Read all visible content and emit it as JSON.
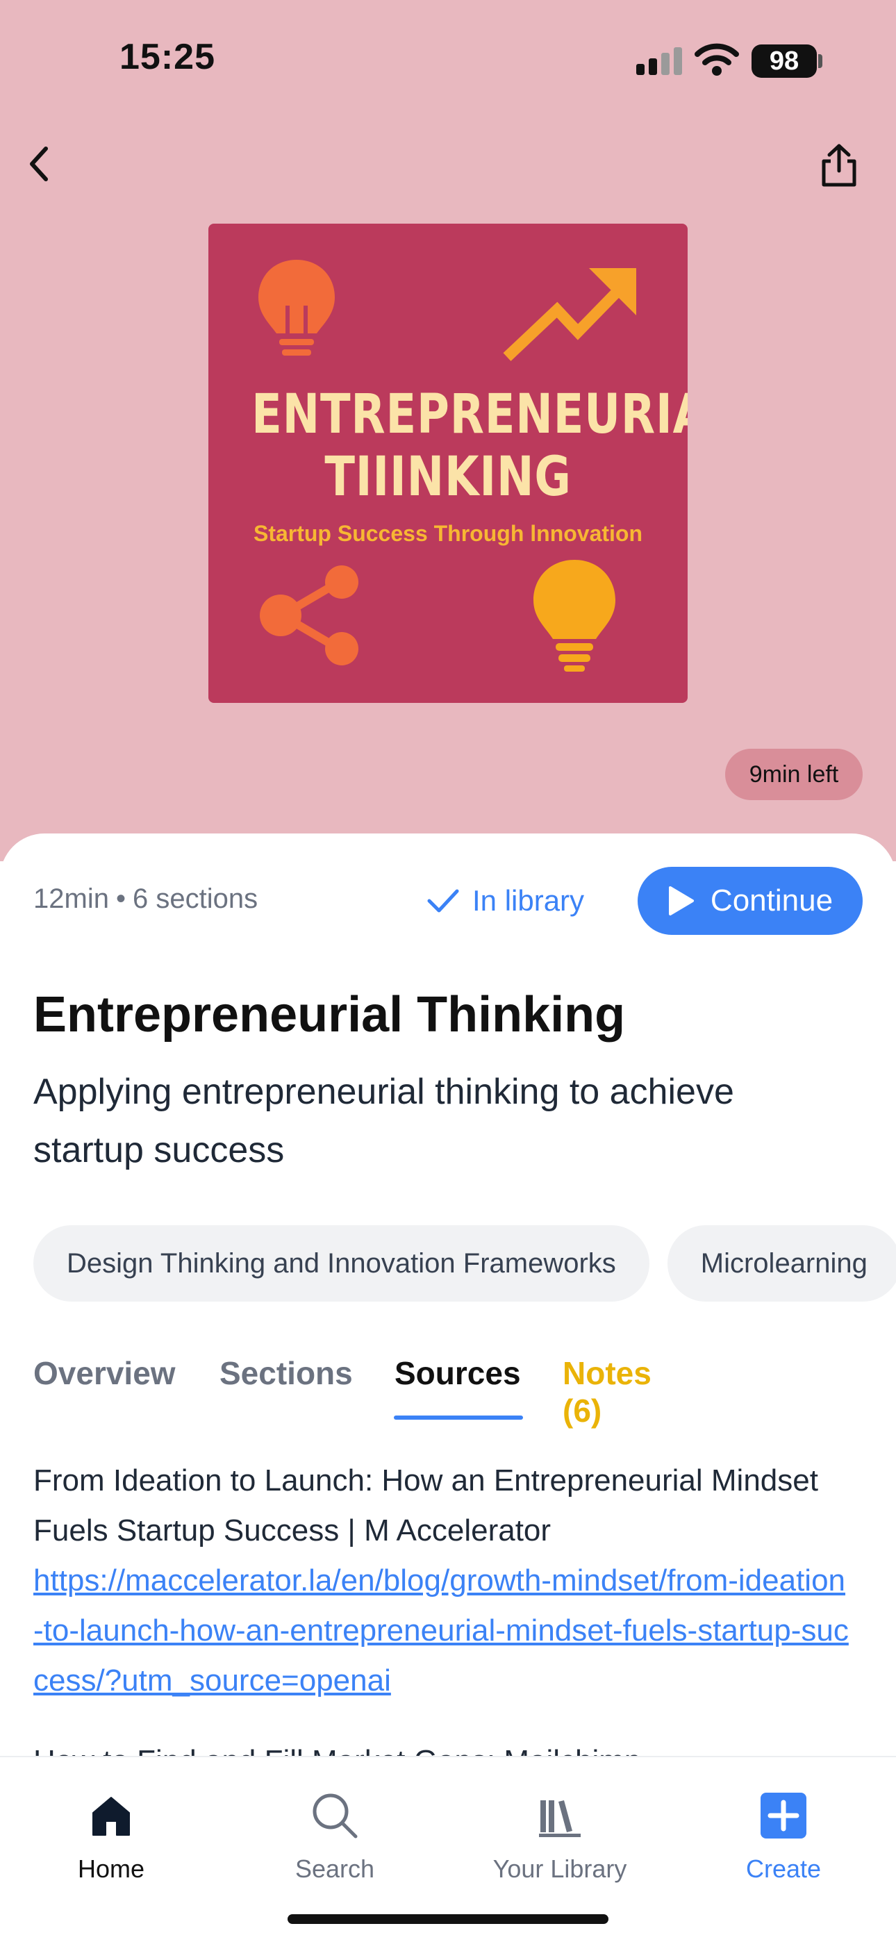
{
  "status_bar": {
    "time": "15:25",
    "battery": "98",
    "icons": [
      "cellular-signal-icon",
      "wifi-icon",
      "battery-icon"
    ]
  },
  "nav": {
    "back_icon": "chevron-left-icon",
    "share_icon": "share-icon"
  },
  "cover": {
    "title_line1": "ENTREPRENEURIAL",
    "title_line2": "TIIINKING",
    "subtitle": "Startup Success Through lnnovation",
    "colors": {
      "background": "#bb3a5c",
      "title": "#fbe3a8",
      "accent": "#f7b733",
      "orange": "#f26b3a"
    }
  },
  "time_left": "9min left",
  "meta": {
    "duration": "12min",
    "separator": "•",
    "sections": "6 sections"
  },
  "actions": {
    "in_library_label": "In library",
    "continue_label": "Continue"
  },
  "course": {
    "title": "Entrepreneurial Thinking",
    "subtitle": "Applying entrepreneurial thinking to achieve startup success"
  },
  "chips": [
    {
      "label": "Design Thinking and Innovation Frameworks"
    },
    {
      "label": "Microlearning"
    }
  ],
  "tabs": [
    {
      "label": "Overview"
    },
    {
      "label": "Sections"
    },
    {
      "label": "Sources",
      "active": true
    },
    {
      "label": "Notes (6)"
    }
  ],
  "sources": [
    {
      "title": "From Ideation to Launch: How an Entrepreneurial Mindset Fuels Startup Success | M Accelerator",
      "url": "https://maccelerator.la/en/blog/growth-mindset/from-ideation-to-launch-how-an-entrepreneurial-mindset-fuels-startup-success/?utm_source=openai"
    },
    {
      "title": "How to Find and Fill Market Gaps: Mailchimp"
    }
  ],
  "tab_bar": [
    {
      "label": "Home",
      "icon": "home-icon",
      "active": true
    },
    {
      "label": "Search",
      "icon": "search-icon"
    },
    {
      "label": "Your Library",
      "icon": "library-icon"
    },
    {
      "label": "Create",
      "icon": "plus-square-icon"
    }
  ],
  "colors": {
    "hero_background": "#e8b8bf",
    "accent_blue": "#3b82f6",
    "notes_yellow": "#eab308",
    "time_left_pill": "#d98e99"
  }
}
